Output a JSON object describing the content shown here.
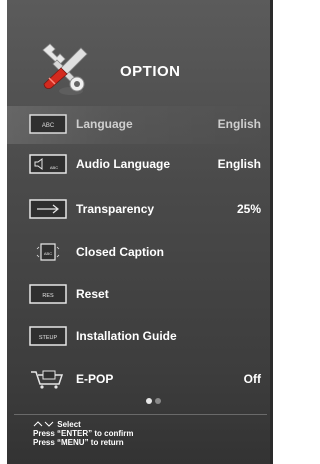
{
  "header": {
    "title": "OPTION",
    "icon": "wrench-screwdriver-icon"
  },
  "menu": {
    "items": [
      {
        "label": "Language",
        "value": "English",
        "icon": "abc-icon",
        "selected": true
      },
      {
        "label": "Audio Language",
        "value": "English",
        "icon": "speaker-abc-icon"
      },
      {
        "label": "Transparency",
        "value": "25%",
        "icon": "arrow-box-icon"
      },
      {
        "label": "Closed Caption",
        "value": "",
        "icon": "cc-page-icon"
      },
      {
        "label": "Reset",
        "value": "",
        "icon": "res-icon"
      },
      {
        "label": "Installation Guide",
        "value": "",
        "icon": "setup-icon"
      },
      {
        "label": "E-POP",
        "value": "Off",
        "icon": "cart-icon"
      }
    ],
    "icon_texts": {
      "abc": "ABC",
      "res": "RES",
      "setup": "STEUP"
    }
  },
  "pagination": {
    "pages": 2,
    "current": 1
  },
  "help": {
    "select": "Select",
    "confirm": "Press “ENTER” to confirm",
    "return": "Press “MENU” to return"
  },
  "colors": {
    "panel": "#4a4a4a",
    "text": "#ffffff",
    "selected_text": "#cfcfcf"
  }
}
